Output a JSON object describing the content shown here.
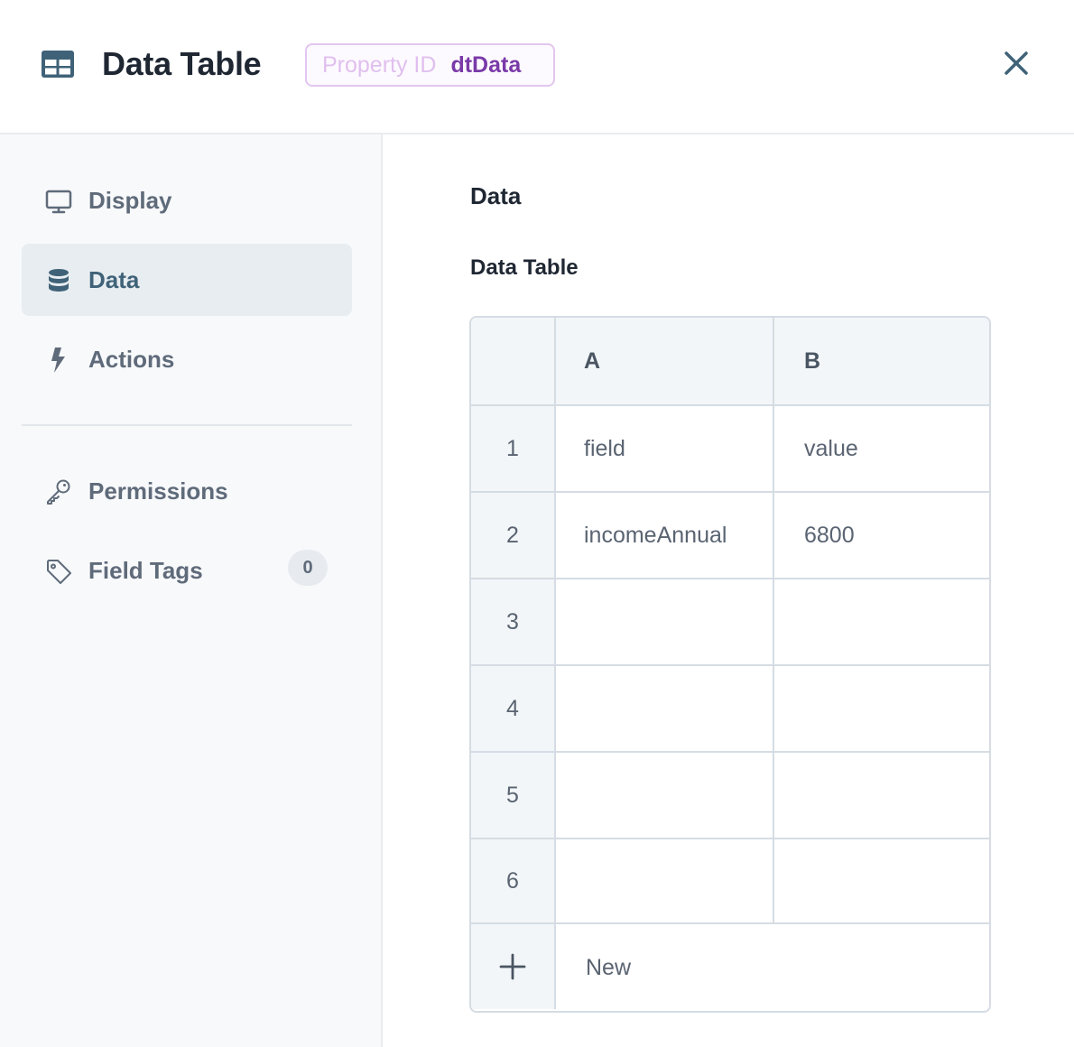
{
  "header": {
    "title": "Data Table",
    "property_label": "Property ID",
    "property_value": "dtData",
    "icon": "table-icon",
    "close_icon": "close-icon"
  },
  "sidebar": {
    "items": [
      {
        "label": "Display",
        "icon": "monitor-icon",
        "active": false
      },
      {
        "label": "Data",
        "icon": "database-icon",
        "active": true
      },
      {
        "label": "Actions",
        "icon": "lightning-icon",
        "active": false
      },
      {
        "label": "Permissions",
        "icon": "key-icon",
        "active": false
      },
      {
        "label": "Field Tags",
        "icon": "tag-icon",
        "active": false,
        "count": "0"
      }
    ]
  },
  "main": {
    "section_title": "Data",
    "field_label": "Data Table",
    "grid": {
      "columns": [
        "A",
        "B"
      ],
      "rows": [
        {
          "num": "1",
          "a": "field",
          "b": "value"
        },
        {
          "num": "2",
          "a": "incomeAnnual",
          "b": "6800"
        },
        {
          "num": "3",
          "a": "",
          "b": ""
        },
        {
          "num": "4",
          "a": "",
          "b": ""
        },
        {
          "num": "5",
          "a": "",
          "b": ""
        },
        {
          "num": "6",
          "a": "",
          "b": ""
        }
      ],
      "new_label": "New"
    }
  },
  "colors": {
    "accent": "#3f6278",
    "badge_text": "#7a3aa8",
    "badge_border": "#e2c6ef"
  }
}
